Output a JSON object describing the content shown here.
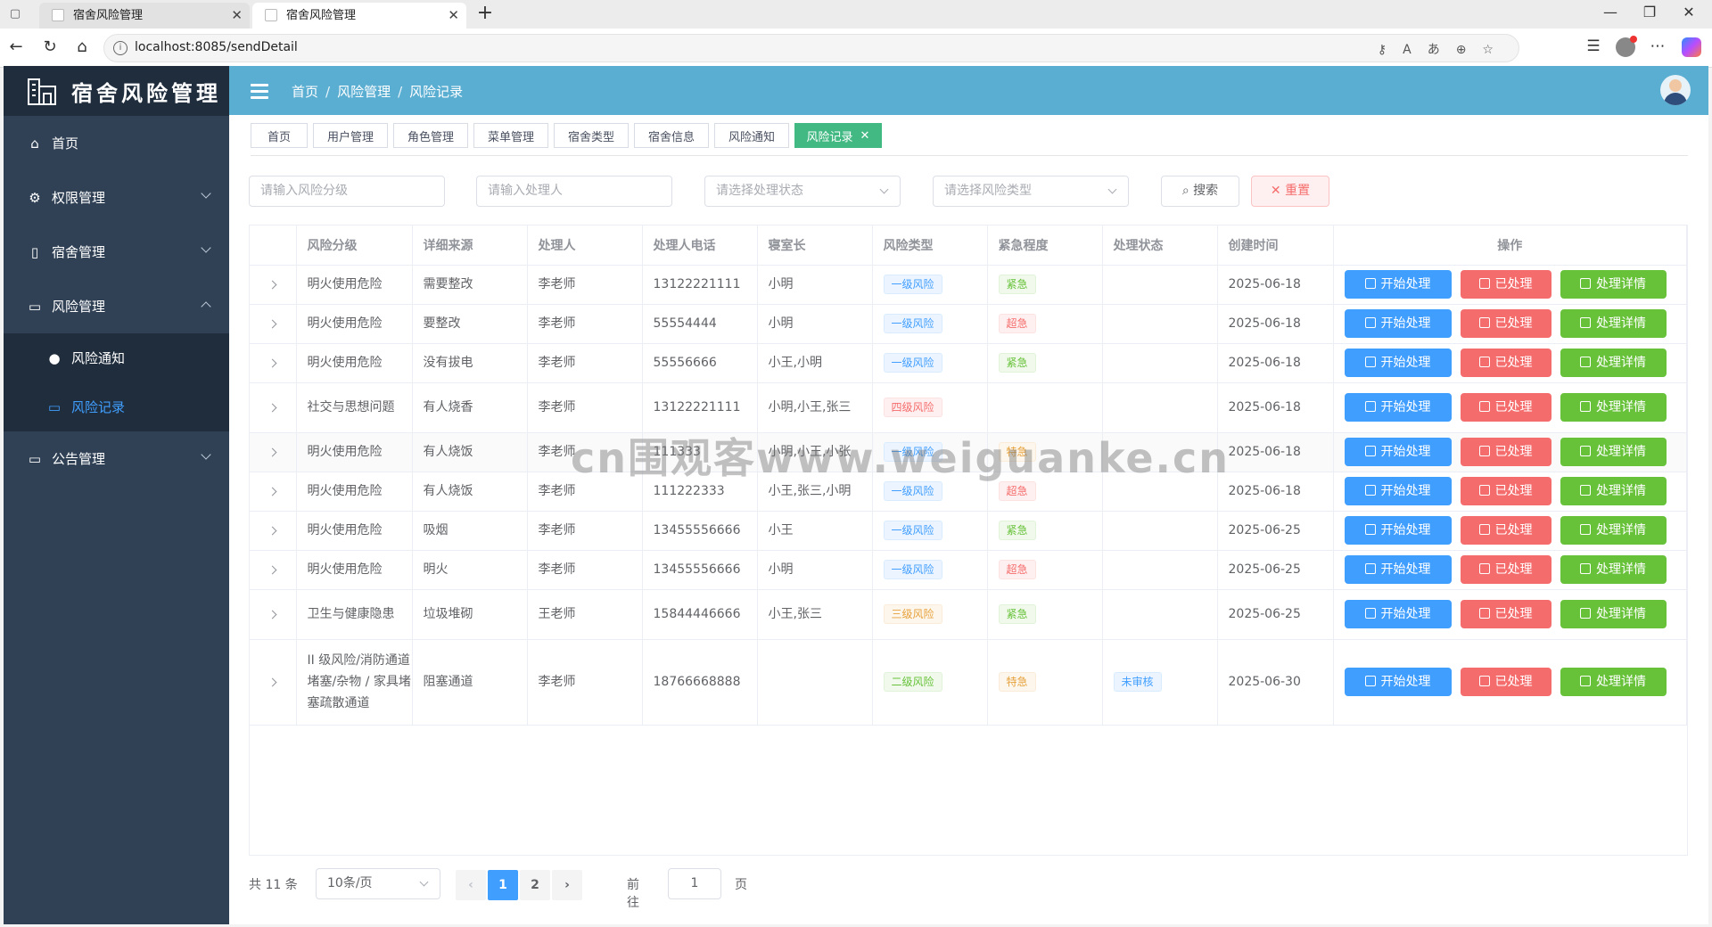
{
  "browser": {
    "tabs": [
      {
        "title": "宿舍风险管理"
      },
      {
        "title": "宿舍风险管理"
      }
    ],
    "url": "localhost:8085/sendDetail"
  },
  "sidebar": {
    "title": "宿舍风险管理",
    "items": [
      {
        "label": "首页"
      },
      {
        "label": "权限管理"
      },
      {
        "label": "宿舍管理"
      },
      {
        "label": "风险管理"
      },
      {
        "label": "公告管理"
      }
    ],
    "sub_items": [
      {
        "label": "风险通知"
      },
      {
        "label": "风险记录"
      }
    ]
  },
  "header": {
    "breadcrumb": [
      "首页",
      "风险管理",
      "风险记录"
    ],
    "sep": "/"
  },
  "tags": [
    "首页",
    "用户管理",
    "角色管理",
    "菜单管理",
    "宿舍类型",
    "宿舍信息",
    "风险通知",
    "风险记录"
  ],
  "filters": {
    "risk_level_placeholder": "请输入风险分级",
    "handler_placeholder": "请输入处理人",
    "status_placeholder": "请选择处理状态",
    "type_placeholder": "请选择风险类型",
    "search_label": "搜索",
    "reset_label": "重置"
  },
  "table": {
    "columns": [
      "风险分级",
      "详细来源",
      "处理人",
      "处理人电话",
      "寝室长",
      "风险类型",
      "紧急程度",
      "处理状态",
      "创建时间",
      "操作"
    ],
    "actions": {
      "start": "开始处理",
      "done": "已处理",
      "detail": "处理详情"
    },
    "rows": [
      {
        "level": "明火使用危险",
        "source": "需要整改",
        "handler": "李老师",
        "phone": "13122221111",
        "leader": "小明",
        "type": "一级风险",
        "urgency": "紧急",
        "status": "",
        "created": "2025-06-18"
      },
      {
        "level": "明火使用危险",
        "source": "要整改",
        "handler": "李老师",
        "phone": "55554444",
        "leader": "小明",
        "type": "一级风险",
        "urgency": "超急",
        "status": "",
        "created": "2025-06-18"
      },
      {
        "level": "明火使用危险",
        "source": "没有拔电",
        "handler": "李老师",
        "phone": "55556666",
        "leader": "小王,小明",
        "type": "一级风险",
        "urgency": "紧急",
        "status": "",
        "created": "2025-06-18"
      },
      {
        "level": "社交与思想问题",
        "source": "有人烧香",
        "handler": "李老师",
        "phone": "13122221111",
        "leader": "小明,小王,张三",
        "type": "四级风险",
        "urgency": "",
        "status": "",
        "created": "2025-06-18"
      },
      {
        "level": "明火使用危险",
        "source": "有人烧饭",
        "handler": "李老师",
        "phone": "111333",
        "leader": "小明,小王,小张",
        "type": "一级风险",
        "urgency": "特急",
        "status": "",
        "created": "2025-06-18"
      },
      {
        "level": "明火使用危险",
        "source": "有人烧饭",
        "handler": "李老师",
        "phone": "111222333",
        "leader": "小王,张三,小明",
        "type": "一级风险",
        "urgency": "超急",
        "status": "",
        "created": "2025-06-18"
      },
      {
        "level": "明火使用危险",
        "source": "吸烟",
        "handler": "李老师",
        "phone": "13455556666",
        "leader": "小王",
        "type": "一级风险",
        "urgency": "紧急",
        "status": "",
        "created": "2025-06-25"
      },
      {
        "level": "明火使用危险",
        "source": "明火",
        "handler": "李老师",
        "phone": "13455556666",
        "leader": "小明",
        "type": "一级风险",
        "urgency": "超急",
        "status": "",
        "created": "2025-06-25"
      },
      {
        "level": "卫生与健康隐患",
        "source": "垃圾堆砌",
        "handler": "王老师",
        "phone": "15844446666",
        "leader": "小王,张三",
        "type": "三级风险",
        "urgency": "紧急",
        "status": "",
        "created": "2025-06-25"
      },
      {
        "level": "II 级风险/消防通道堵塞/杂物 / 家具堵塞疏散通道",
        "source": "阻塞通道",
        "handler": "李老师",
        "phone": "18766668888",
        "leader": "",
        "type": "二级风险",
        "urgency": "特急",
        "status": "未审核",
        "created": "2025-06-30"
      }
    ]
  },
  "pagination": {
    "total": "共 11 条",
    "page_size": "10条/页",
    "pages": [
      "1",
      "2"
    ],
    "goto_label": "前往",
    "goto_value": "1",
    "page_label": "页"
  },
  "watermark": "cn围观客www.weiguanke.cn",
  "colors": {
    "sidebar_bg": "#304156",
    "header_bg": "#5aaed2",
    "active_tag": "#42b983",
    "primary": "#409eff",
    "danger": "#f56c6c",
    "success": "#67c23a"
  }
}
